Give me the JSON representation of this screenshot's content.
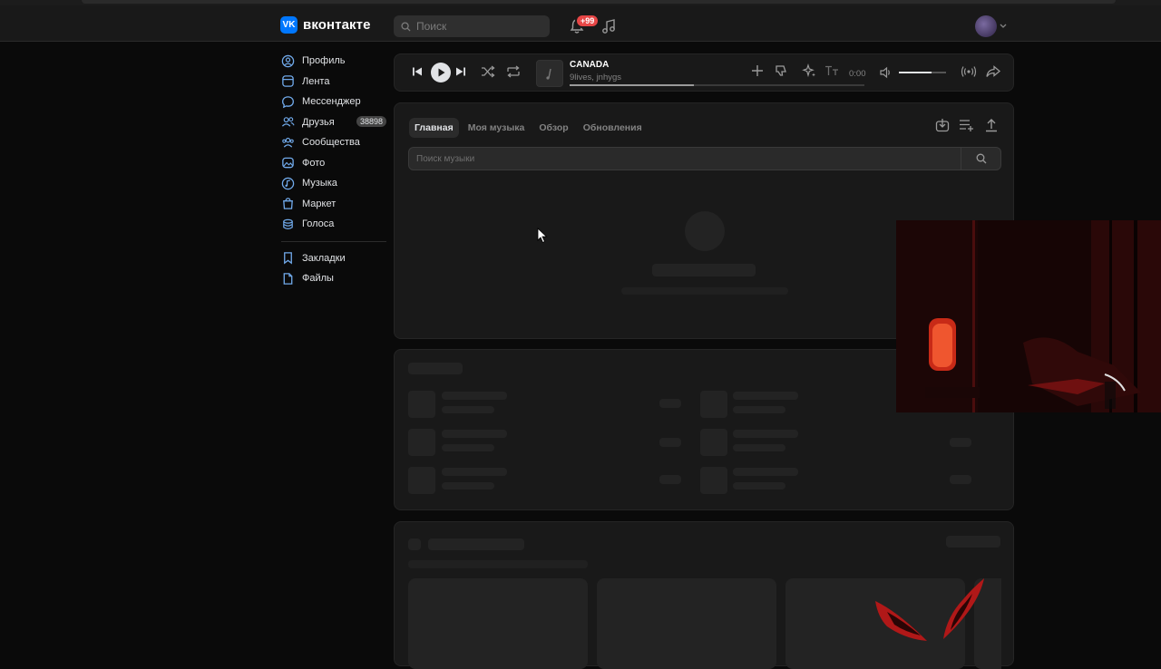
{
  "header": {
    "logo_text": "вконтакте",
    "search_placeholder": "Поиск",
    "notification_count": "+99"
  },
  "sidebar": {
    "items": [
      {
        "label": "Профиль",
        "icon": "user-circle-icon"
      },
      {
        "label": "Лента",
        "icon": "feed-icon"
      },
      {
        "label": "Мессенджер",
        "icon": "message-icon"
      },
      {
        "label": "Друзья",
        "icon": "friends-icon",
        "count": "38898"
      },
      {
        "label": "Сообщества",
        "icon": "communities-icon"
      },
      {
        "label": "Фото",
        "icon": "photo-icon"
      },
      {
        "label": "Музыка",
        "icon": "music-icon"
      },
      {
        "label": "Маркет",
        "icon": "market-icon"
      },
      {
        "label": "Голоса",
        "icon": "coins-icon"
      }
    ],
    "secondary": [
      {
        "label": "Закладки",
        "icon": "bookmark-icon"
      },
      {
        "label": "Файлы",
        "icon": "file-icon"
      }
    ]
  },
  "player": {
    "track_title": "CANADA",
    "track_artist": "9lives, jnhygs",
    "time": "0:00",
    "progress": 0.42,
    "volume": 0.7
  },
  "music": {
    "tabs": [
      "Главная",
      "Моя музыка",
      "Обзор",
      "Обновления"
    ],
    "active_tab": 0,
    "search_placeholder": "Поиск музыки"
  },
  "colors": {
    "accent": "#0077ff",
    "background": "#0a0a0a",
    "surface": "#191919",
    "notification": "#e64646"
  }
}
